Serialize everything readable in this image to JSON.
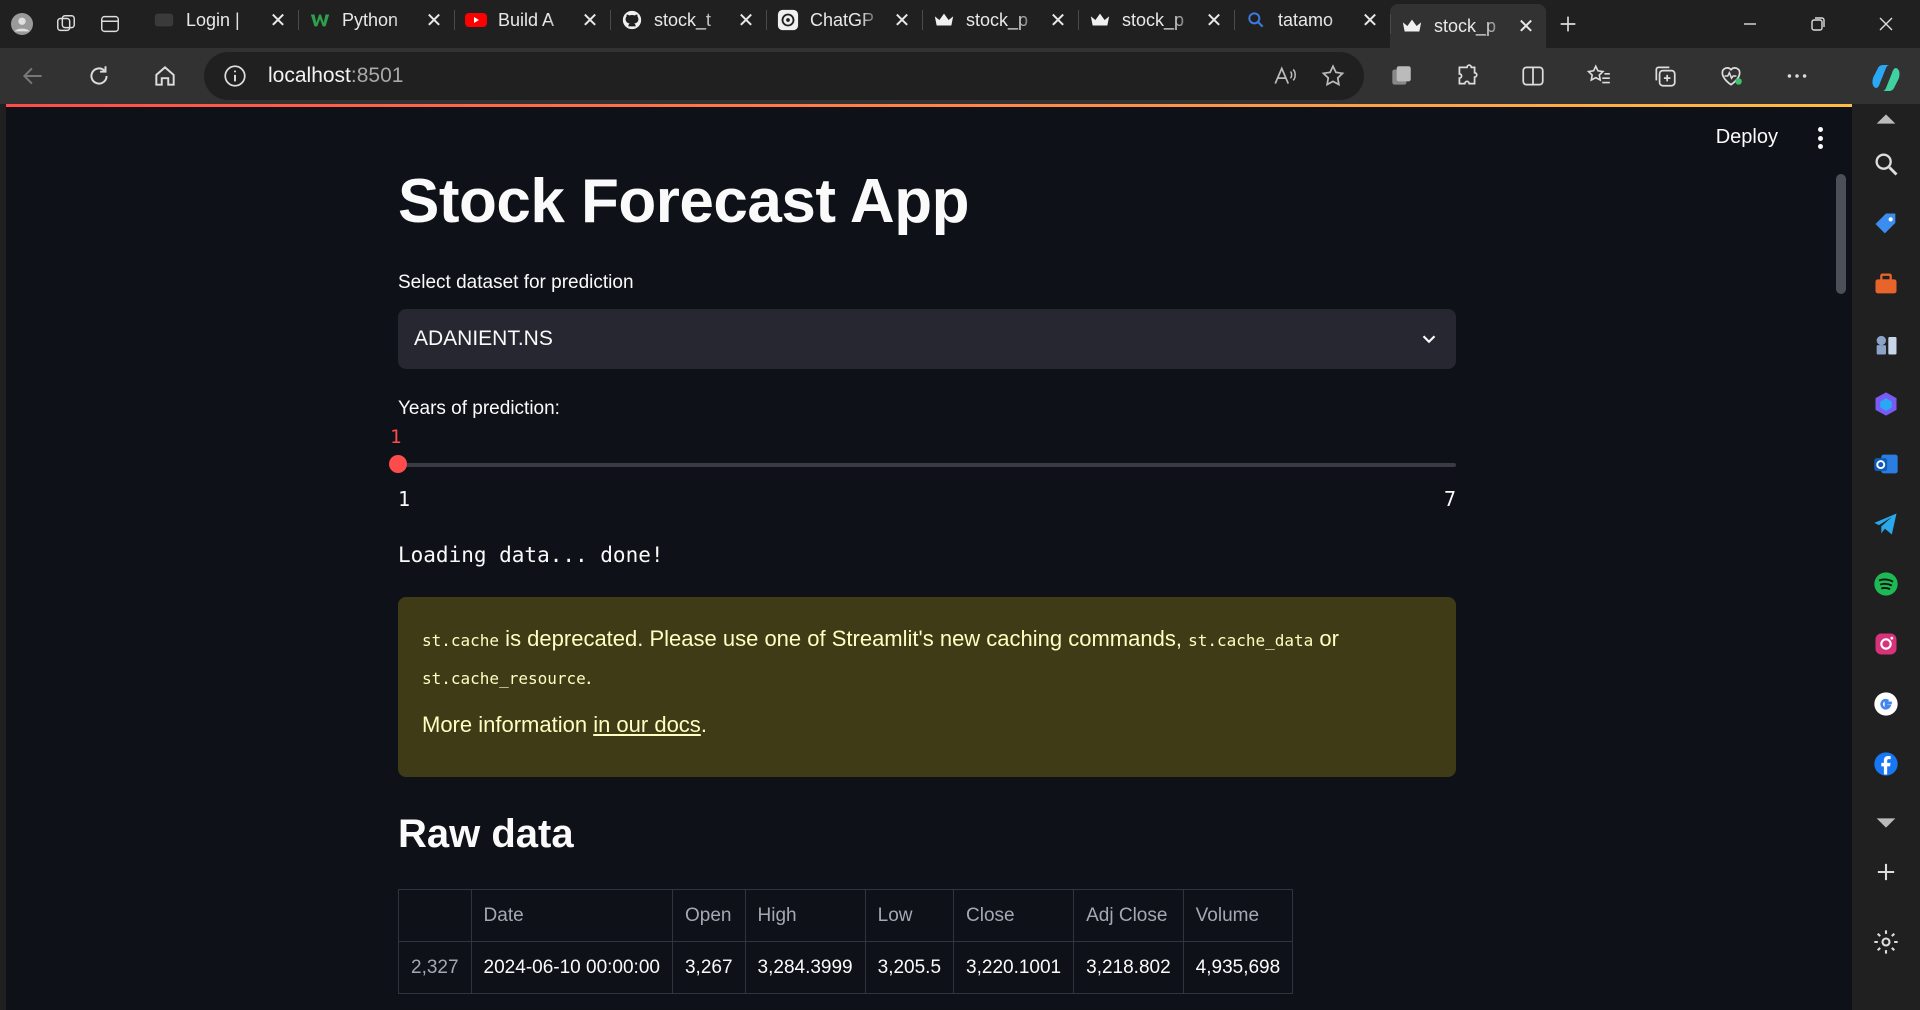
{
  "browser": {
    "tabs": [
      {
        "title": "Login |",
        "favicon": "dark-site-icon"
      },
      {
        "title": "Python",
        "favicon": "w3-icon"
      },
      {
        "title": "Build A",
        "favicon": "youtube-icon"
      },
      {
        "title": "stock_t",
        "favicon": "github-icon"
      },
      {
        "title": "ChatGP",
        "favicon": "chatgpt-icon"
      },
      {
        "title": "stock_p",
        "favicon": "streamlit-crown-icon"
      },
      {
        "title": "stock_p",
        "favicon": "streamlit-crown-icon"
      },
      {
        "title": "tatamo",
        "favicon": "search-icon"
      },
      {
        "title": "stock_p",
        "favicon": "streamlit-crown-icon",
        "active": true
      }
    ],
    "url_host": "localhost",
    "url_port": ":8501"
  },
  "app": {
    "deploy_label": "Deploy",
    "title": "Stock Forecast App",
    "select_label": "Select dataset for prediction",
    "select_value": "ADANIENT.NS",
    "slider_label": "Years of prediction:",
    "slider_value": 1,
    "slider_min": "1",
    "slider_max": "7",
    "slider_value_text": "1",
    "loading_text": "Loading data... done!",
    "warning": {
      "code1": "st.cache",
      "text1": " is deprecated. Please use one of Streamlit's new caching commands, ",
      "code2": "st.cache_data",
      "text2": " or",
      "code3": "st.cache_resource",
      "text3": ".",
      "more_prefix": "More information ",
      "link_text": "in our docs",
      "more_suffix": "."
    },
    "raw_data_heading": "Raw data",
    "table": {
      "headers": [
        "",
        "Date",
        "Open",
        "High",
        "Low",
        "Close",
        "Adj Close",
        "Volume"
      ],
      "rows": [
        [
          "2,327",
          "2024-06-10 00:00:00",
          "3,267",
          "3,284.3999",
          "3,205.5",
          "3,220.1001",
          "3,218.802",
          "4,935,698"
        ]
      ]
    }
  },
  "colors": {
    "accent": "#ff4b4b",
    "page_bg": "#0e1117",
    "warning_bg": "#3e3b16"
  }
}
